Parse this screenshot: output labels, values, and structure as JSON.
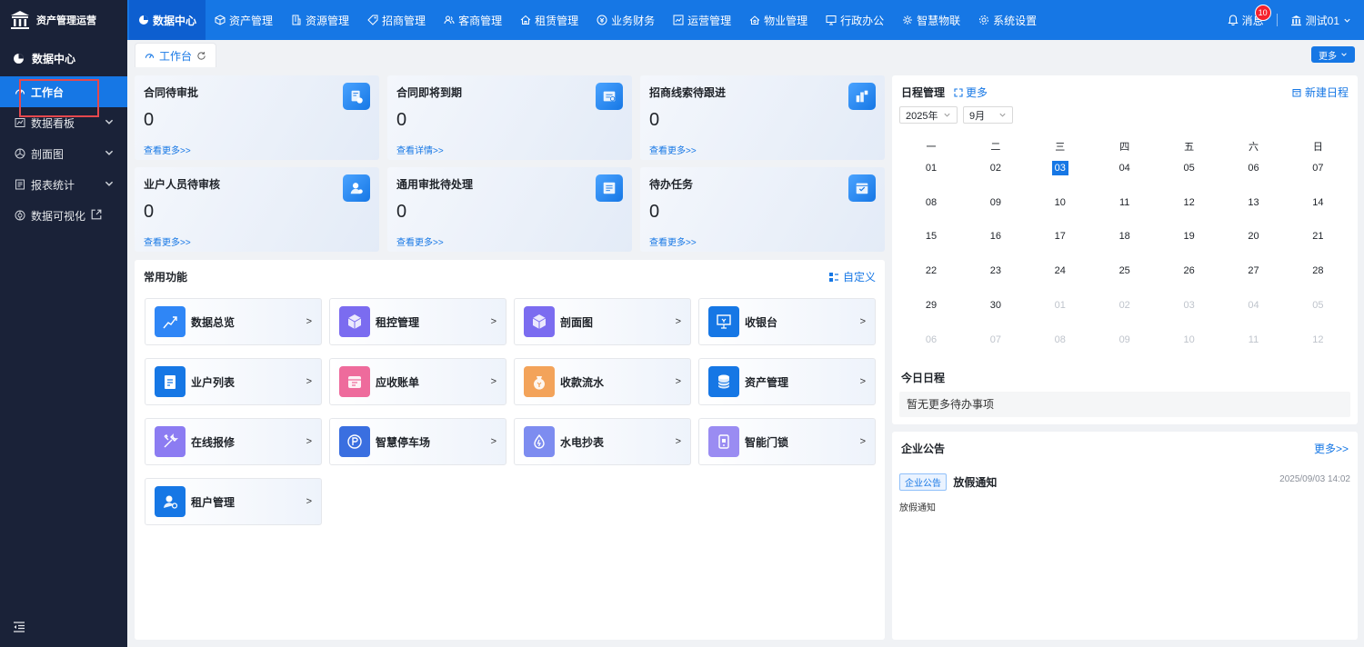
{
  "brand": {
    "title": "资产管理运营"
  },
  "topnav": [
    {
      "label": "数据中心",
      "icon": "pie-chart-icon",
      "active": true
    },
    {
      "label": "资产管理",
      "icon": "cube-icon"
    },
    {
      "label": "资源管理",
      "icon": "building-icon"
    },
    {
      "label": "招商管理",
      "icon": "tag-icon"
    },
    {
      "label": "客商管理",
      "icon": "users-icon"
    },
    {
      "label": "租赁管理",
      "icon": "home-icon"
    },
    {
      "label": "业务财务",
      "icon": "coin-icon"
    },
    {
      "label": "运营管理",
      "icon": "chart-icon"
    },
    {
      "label": "物业管理",
      "icon": "house-icon"
    },
    {
      "label": "行政办公",
      "icon": "monitor-icon"
    },
    {
      "label": "智慧物联",
      "icon": "iot-icon"
    },
    {
      "label": "系统设置",
      "icon": "gear-icon"
    }
  ],
  "header": {
    "messages_label": "消息",
    "messages_count": "10",
    "user_name": "测试01"
  },
  "sidebar": {
    "title": "数据中心",
    "items": [
      {
        "label": "工作台",
        "icon": "dashboard-icon",
        "active": true
      },
      {
        "label": "数据看板",
        "icon": "board-icon",
        "arrow": true
      },
      {
        "label": "剖面图",
        "icon": "section-icon",
        "arrow": true
      },
      {
        "label": "报表统计",
        "icon": "report-icon",
        "arrow": true
      },
      {
        "label": "数据可视化",
        "icon": "visual-icon",
        "external": true
      }
    ]
  },
  "tabs": {
    "active_label": "工作台",
    "more_label": "更多"
  },
  "stat_cards": [
    {
      "title": "合同待审批",
      "value": "0",
      "link": "查看更多>>"
    },
    {
      "title": "合同即将到期",
      "value": "0",
      "link": "查看详情>>"
    },
    {
      "title": "招商线索待跟进",
      "value": "0",
      "link": "查看更多>>"
    },
    {
      "title": "业户人员待审核",
      "value": "0",
      "link": "查看更多>>"
    },
    {
      "title": "通用审批待处理",
      "value": "0",
      "link": "查看更多>>"
    },
    {
      "title": "待办任务",
      "value": "0",
      "link": "查看更多>>"
    }
  ],
  "functions": {
    "title": "常用功能",
    "customize_label": "自定义",
    "arrow": ">",
    "items": [
      {
        "label": "数据总览",
        "icon": "trend-icon",
        "color": "#2f86f6"
      },
      {
        "label": "租控管理",
        "icon": "box-icon",
        "color": "#7b6cf0"
      },
      {
        "label": "剖面图",
        "icon": "box-icon",
        "color": "#7b6cf0"
      },
      {
        "label": "收银台",
        "icon": "cashier-icon",
        "color": "#1677e5"
      },
      {
        "label": "业户列表",
        "icon": "clipboard-icon",
        "color": "#1677e5"
      },
      {
        "label": "应收账单",
        "icon": "calendar-bill-icon",
        "color": "#ee6b9c"
      },
      {
        "label": "收款流水",
        "icon": "money-bag-icon",
        "color": "#f3a35a"
      },
      {
        "label": "资产管理",
        "icon": "database-icon",
        "color": "#1677e5"
      },
      {
        "label": "在线报修",
        "icon": "tools-icon",
        "color": "#8c7cf2"
      },
      {
        "label": "智慧停车场",
        "icon": "parking-icon",
        "color": "#3a6fe0"
      },
      {
        "label": "水电抄表",
        "icon": "water-drop-icon",
        "color": "#7d8cf0"
      },
      {
        "label": "智能门锁",
        "icon": "door-lock-icon",
        "color": "#9a8cf2"
      },
      {
        "label": "租户管理",
        "icon": "tenant-icon",
        "color": "#1677e5"
      }
    ]
  },
  "schedule": {
    "title": "日程管理",
    "more_label": "更多",
    "new_label": "新建日程",
    "year": "2025年",
    "month": "9月",
    "weekdays": [
      "一",
      "二",
      "三",
      "四",
      "五",
      "六",
      "日"
    ],
    "days": [
      {
        "d": "01"
      },
      {
        "d": "02"
      },
      {
        "d": "03",
        "today": true
      },
      {
        "d": "04"
      },
      {
        "d": "05"
      },
      {
        "d": "06"
      },
      {
        "d": "07"
      },
      {
        "d": "08"
      },
      {
        "d": "09"
      },
      {
        "d": "10"
      },
      {
        "d": "11"
      },
      {
        "d": "12"
      },
      {
        "d": "13"
      },
      {
        "d": "14"
      },
      {
        "d": "15"
      },
      {
        "d": "16"
      },
      {
        "d": "17"
      },
      {
        "d": "18"
      },
      {
        "d": "19"
      },
      {
        "d": "20"
      },
      {
        "d": "21"
      },
      {
        "d": "22"
      },
      {
        "d": "23"
      },
      {
        "d": "24"
      },
      {
        "d": "25"
      },
      {
        "d": "26"
      },
      {
        "d": "27"
      },
      {
        "d": "28"
      },
      {
        "d": "29"
      },
      {
        "d": "30"
      },
      {
        "d": "01",
        "dim": true
      },
      {
        "d": "02",
        "dim": true
      },
      {
        "d": "03",
        "dim": true
      },
      {
        "d": "04",
        "dim": true
      },
      {
        "d": "05",
        "dim": true
      },
      {
        "d": "06",
        "dim": true
      },
      {
        "d": "07",
        "dim": true
      },
      {
        "d": "08",
        "dim": true
      },
      {
        "d": "09",
        "dim": true
      },
      {
        "d": "10",
        "dim": true
      },
      {
        "d": "11",
        "dim": true
      },
      {
        "d": "12",
        "dim": true
      }
    ],
    "today_title": "今日日程",
    "today_empty": "暂无更多待办事项"
  },
  "announcements": {
    "title": "企业公告",
    "more_label": "更多>>",
    "items": [
      {
        "tag": "企业公告",
        "title": "放假通知",
        "time": "2025/09/03 14:02",
        "body": "放假通知"
      }
    ]
  }
}
